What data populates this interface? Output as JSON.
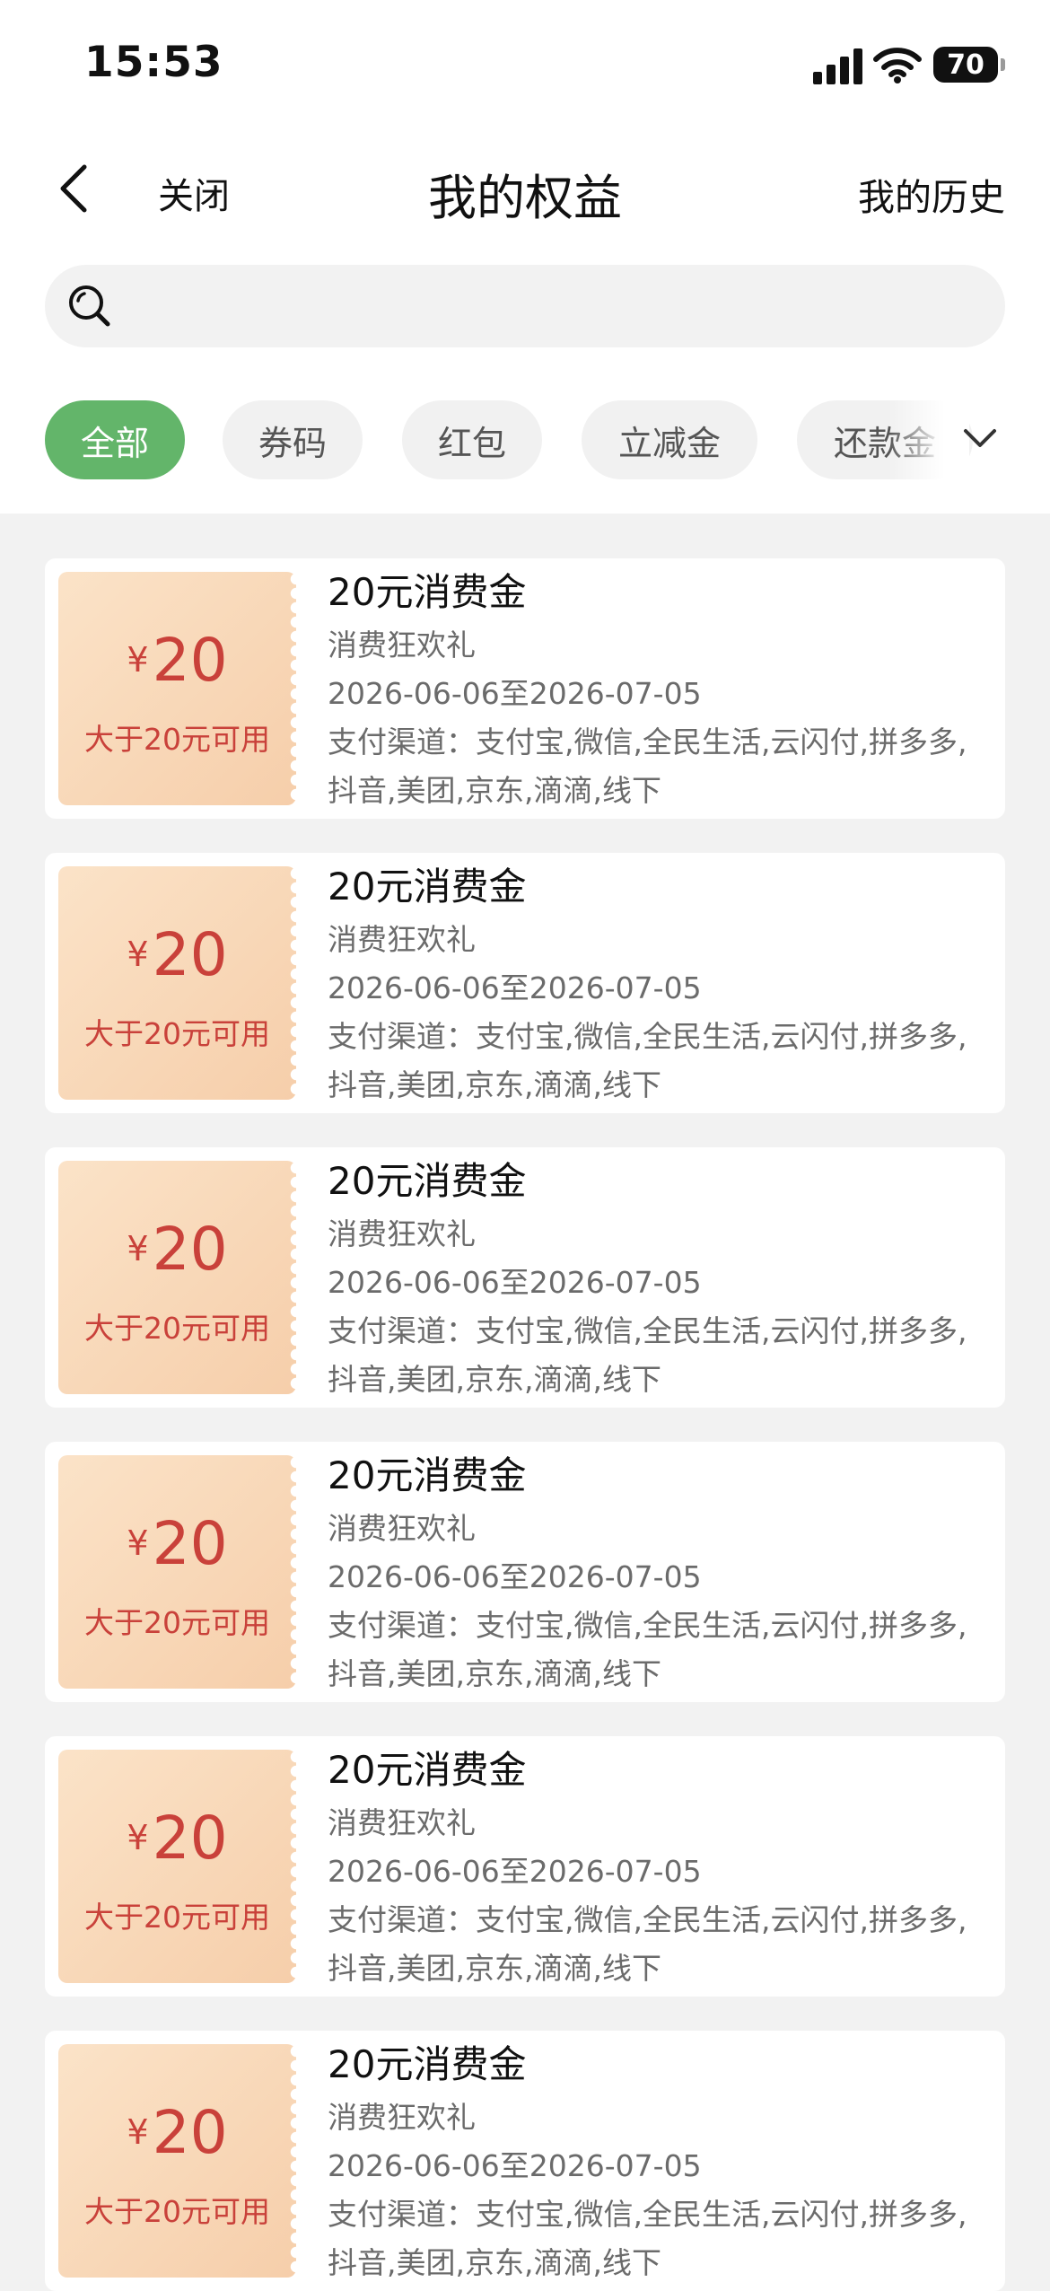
{
  "status_bar": {
    "time": "15:53",
    "battery": "70"
  },
  "nav": {
    "close_label": "关闭",
    "title": "我的权益",
    "history_label": "我的历史"
  },
  "search": {
    "placeholder": ""
  },
  "tabs": [
    {
      "label": "全部",
      "active": true
    },
    {
      "label": "券码",
      "active": false
    },
    {
      "label": "红包",
      "active": false
    },
    {
      "label": "立减金",
      "active": false
    },
    {
      "label": "还款金",
      "active": false
    }
  ],
  "colors": {
    "accent_green": "#63b56a",
    "coupon_red": "#c9413a",
    "coupon_bg": "#f6ceaa"
  },
  "coupons": [
    {
      "symbol": "¥",
      "amount": "20",
      "condition": "大于20元可用",
      "title": "20元消费金",
      "campaign": "消费狂欢礼",
      "validity": "2026-06-06至2026-07-05",
      "channels": "支付渠道：支付宝,微信,全民生活,云闪付,拼多多,抖音,美团,京东,滴滴,线下"
    },
    {
      "symbol": "¥",
      "amount": "20",
      "condition": "大于20元可用",
      "title": "20元消费金",
      "campaign": "消费狂欢礼",
      "validity": "2026-06-06至2026-07-05",
      "channels": "支付渠道：支付宝,微信,全民生活,云闪付,拼多多,抖音,美团,京东,滴滴,线下"
    },
    {
      "symbol": "¥",
      "amount": "20",
      "condition": "大于20元可用",
      "title": "20元消费金",
      "campaign": "消费狂欢礼",
      "validity": "2026-06-06至2026-07-05",
      "channels": "支付渠道：支付宝,微信,全民生活,云闪付,拼多多,抖音,美团,京东,滴滴,线下"
    },
    {
      "symbol": "¥",
      "amount": "20",
      "condition": "大于20元可用",
      "title": "20元消费金",
      "campaign": "消费狂欢礼",
      "validity": "2026-06-06至2026-07-05",
      "channels": "支付渠道：支付宝,微信,全民生活,云闪付,拼多多,抖音,美团,京东,滴滴,线下"
    },
    {
      "symbol": "¥",
      "amount": "20",
      "condition": "大于20元可用",
      "title": "20元消费金",
      "campaign": "消费狂欢礼",
      "validity": "2026-06-06至2026-07-05",
      "channels": "支付渠道：支付宝,微信,全民生活,云闪付,拼多多,抖音,美团,京东,滴滴,线下"
    },
    {
      "symbol": "¥",
      "amount": "20",
      "condition": "大于20元可用",
      "title": "20元消费金",
      "campaign": "消费狂欢礼",
      "validity": "2026-06-06至2026-07-05",
      "channels": "支付渠道：支付宝,微信,全民生活,云闪付,拼多多,抖音,美团,京东,滴滴,线下"
    }
  ]
}
